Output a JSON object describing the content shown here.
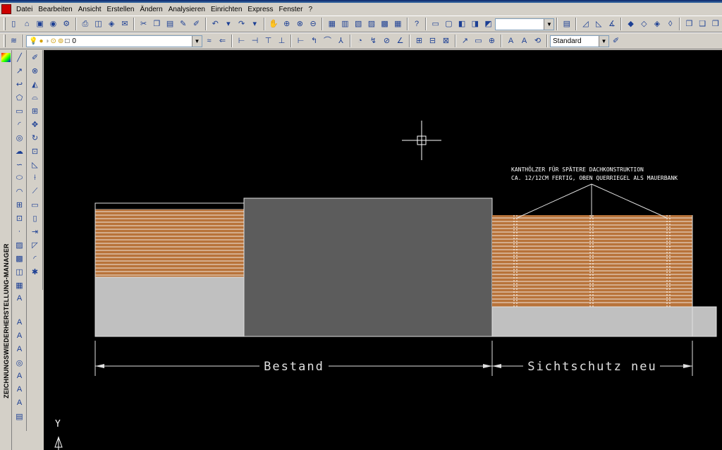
{
  "menu": [
    "Datei",
    "Bearbeiten",
    "Ansicht",
    "Erstellen",
    "Ändern",
    "Analysieren",
    "Einrichten",
    "Express",
    "Fenster",
    "?"
  ],
  "toolbar2": {
    "layer_value": "0",
    "style_value": "Standard"
  },
  "palette": {
    "label": "ZEICHNUNGSWIEDERHERSTELLUNG-MANAGER"
  },
  "drawing": {
    "annotation_line1": "KANTHÖLZER FÜR SPÄTERE DACHKONSTRUKTION",
    "annotation_line2": "CA. 12/12CM FERTIG, OBEN QUERRIEGEL ALS MAUERBANK",
    "dim_left": "Bestand",
    "dim_right": "Sichtschutz neu",
    "ucs_y": "Y"
  },
  "colors": {
    "wood": "#b8733a",
    "gray_light": "#c0c0c0",
    "gray_dark": "#5c5c5c",
    "background": "#000000"
  }
}
